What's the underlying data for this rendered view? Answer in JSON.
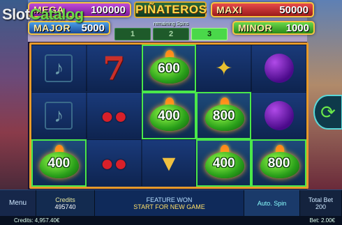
{
  "watermark": {
    "left": "Slot",
    "right": "Catalog"
  },
  "jackpots": {
    "mega": {
      "label": "MEGA",
      "value": "100000"
    },
    "major": {
      "label": "MAJOR",
      "value": "5000"
    },
    "maxi": {
      "label": "MAXI",
      "value": "50000"
    },
    "minor": {
      "label": "MINOR",
      "value": "1000"
    }
  },
  "logo": "PIÑATEROS",
  "remaining_spins": {
    "label": "remaining Spins",
    "boxes": [
      "1",
      "2",
      "3"
    ],
    "active_index": 2
  },
  "reels": [
    [
      {
        "type": "guitar",
        "icon": "guitar-icon"
      },
      {
        "type": "seven",
        "icon": "seven-icon",
        "glyph": "7"
      },
      {
        "type": "pepper",
        "value": "600"
      },
      {
        "type": "maracas",
        "icon": "maracas-icon"
      },
      {
        "type": "plum",
        "icon": "plum-icon"
      }
    ],
    [
      {
        "type": "guitar",
        "icon": "guitar-icon"
      },
      {
        "type": "cherry",
        "icon": "cherry-icon"
      },
      {
        "type": "pepper",
        "value": "400"
      },
      {
        "type": "pepper",
        "value": "800"
      },
      {
        "type": "plum",
        "icon": "plum-icon"
      }
    ],
    [
      {
        "type": "pepper",
        "value": "400"
      },
      {
        "type": "cherry",
        "icon": "cherry-icon"
      },
      {
        "type": "drink",
        "icon": "drink-icon"
      },
      {
        "type": "pepper",
        "value": "400"
      },
      {
        "type": "pepper",
        "value": "800"
      }
    ]
  ],
  "bottom_bar": {
    "menu": "Menu",
    "credits_label": "Credits",
    "credits_value": "495740",
    "feature_line1": "FEATURE WON",
    "feature_line2": "START FOR NEW GAME",
    "auto_spin": "Auto. Spin",
    "total_bet_label": "Total Bet",
    "total_bet_value": "200"
  },
  "status_bar": {
    "credits": "Credits: 4,957.40€",
    "bet": "Bet: 2.00€"
  },
  "colors": {
    "frame": "#e89a2a",
    "win_border": "#4ae84a",
    "pepper_green": "#2aa01a"
  }
}
